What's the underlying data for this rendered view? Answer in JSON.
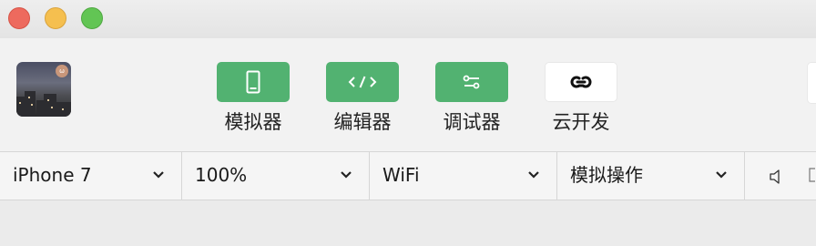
{
  "window": {
    "controls": [
      "close",
      "minimize",
      "zoom"
    ]
  },
  "toolbar": {
    "tools": [
      {
        "id": "simulator",
        "label": "模拟器",
        "icon": "phone-icon",
        "color": "#52b271"
      },
      {
        "id": "editor",
        "label": "编辑器",
        "icon": "code-icon",
        "color": "#52b271"
      },
      {
        "id": "debugger",
        "label": "调试器",
        "icon": "debug-sliders-icon",
        "color": "#52b271"
      },
      {
        "id": "cloud",
        "label": "云开发",
        "icon": "cloud-link-icon",
        "color": "#ffffff"
      }
    ]
  },
  "selectors": {
    "device": "iPhone 7",
    "zoom": "100%",
    "network": "WiFi",
    "operation": "模拟操作"
  },
  "icons": {
    "volume": "speaker-icon"
  }
}
